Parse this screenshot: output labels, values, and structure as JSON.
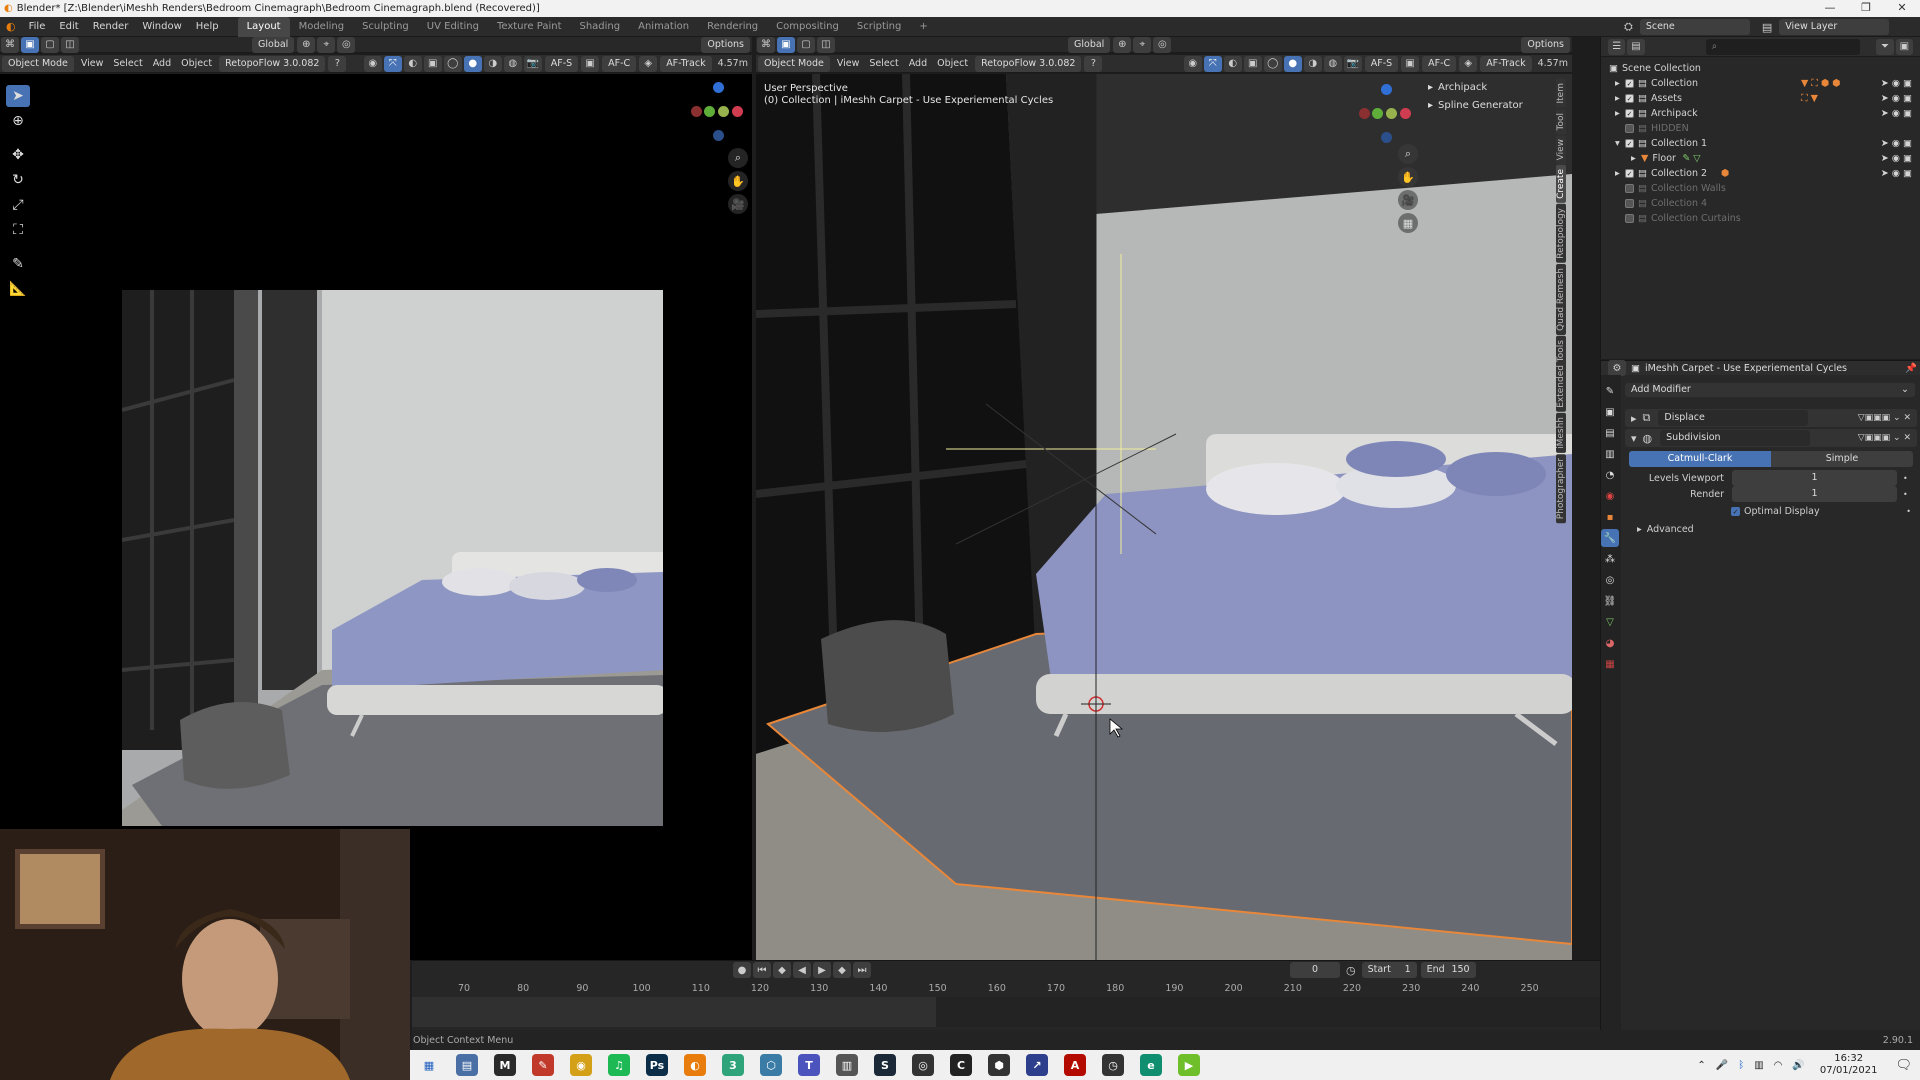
{
  "titlebar": {
    "text": "Blender* [Z:\\Blender\\iMeshh Renders\\Bedroom Cinemagraph\\Bedroom Cinemagraph.blend (Recovered)]"
  },
  "menu": [
    "File",
    "Edit",
    "Render",
    "Window",
    "Help"
  ],
  "workspaces": [
    "Layout",
    "Modeling",
    "Sculpting",
    "UV Editing",
    "Texture Paint",
    "Shading",
    "Animation",
    "Rendering",
    "Compositing",
    "Scripting"
  ],
  "active_workspace": "Layout",
  "scene": {
    "name": "Scene",
    "view_layer": "View Layer"
  },
  "left_viewport_header": {
    "mode": "Object Mode",
    "menus": [
      "View",
      "Select",
      "Add",
      "Object"
    ],
    "addon": "RetopoFlow 3.0.082",
    "orientation": "Global",
    "options": "Options",
    "af_s": "AF-S",
    "af_c": "AF-C",
    "af_track": "AF-Track",
    "distance": "4.57m"
  },
  "main_viewport_header": {
    "mode": "Object Mode",
    "menus": [
      "View",
      "Select",
      "Add",
      "Object"
    ],
    "addon": "RetopoFlow 3.0.082",
    "orientation": "Global",
    "options": "Options",
    "af_s": "AF-S",
    "af_c": "AF-C",
    "af_track": "AF-Track",
    "distance": "4.57m"
  },
  "main_viewport": {
    "perspective": "User Perspective",
    "collection_info": "(0) Collection | iMeshh Carpet - Use Experiemental Cycles",
    "n_panel_items": [
      "Archipack",
      "Spline Generator"
    ]
  },
  "n_panel_tabs": [
    "Item",
    "Tool",
    "View",
    "Create",
    "Retopology",
    "Quad Remesh",
    "Extended Tools",
    "iMeshh",
    "Photographer"
  ],
  "outliner": {
    "root": "Scene Collection",
    "items": [
      {
        "label": "Collection",
        "enabled": true
      },
      {
        "label": "Assets",
        "enabled": true
      },
      {
        "label": "Archipack",
        "enabled": true
      },
      {
        "label": "HIDDEN",
        "enabled": false
      },
      {
        "label": "Collection 1",
        "enabled": true
      },
      {
        "label": "Floor",
        "enabled": true
      },
      {
        "label": "Collection 2",
        "enabled": true
      },
      {
        "label": "Collection Walls",
        "enabled": false
      },
      {
        "label": "Collection 4",
        "enabled": false
      },
      {
        "label": "Collection Curtains",
        "enabled": false
      }
    ]
  },
  "properties": {
    "object_name": "iMeshh Carpet - Use Experiemental Cycles",
    "add_modifier": "Add Modifier",
    "modifiers": [
      {
        "name": "Displace"
      },
      {
        "name": "Subdivision"
      }
    ],
    "subdiv_types": [
      "Catmull-Clark",
      "Simple"
    ],
    "levels_viewport_label": "Levels Viewport",
    "levels_viewport": "1",
    "render_label": "Render",
    "render": "1",
    "optimal_display": "Optimal Display",
    "advanced": "Advanced"
  },
  "timeline": {
    "current_frame": "0",
    "start_label": "Start",
    "start": "1",
    "end_label": "End",
    "end": "150",
    "ticks": [
      "70",
      "80",
      "90",
      "100",
      "110",
      "120",
      "130",
      "140",
      "150",
      "160",
      "170",
      "180",
      "190",
      "200",
      "210",
      "220",
      "230",
      "240",
      "250"
    ]
  },
  "status": {
    "left": "Object Context Menu",
    "version": "2.90.1"
  },
  "taskbar": {
    "time": "16:32",
    "date": "07/01/2021",
    "icons": [
      {
        "name": "explorer",
        "glyph": "▤",
        "color": "#4a6fa5"
      },
      {
        "name": "app-m",
        "glyph": "M",
        "color": "#2a2a2a"
      },
      {
        "name": "pen",
        "glyph": "✎",
        "color": "#c0392b"
      },
      {
        "name": "chrome",
        "glyph": "◉",
        "color": "#d4a017"
      },
      {
        "name": "spotify",
        "glyph": "♫",
        "color": "#1db954"
      },
      {
        "name": "photoshop",
        "glyph": "Ps",
        "color": "#0c2d48"
      },
      {
        "name": "blender",
        "glyph": "◐",
        "color": "#e87d0d"
      },
      {
        "name": "app-3",
        "glyph": "3",
        "color": "#2fa37a"
      },
      {
        "name": "cube",
        "glyph": "⬡",
        "color": "#3a7ca5"
      },
      {
        "name": "teams",
        "glyph": "T",
        "color": "#4b53bc"
      },
      {
        "name": "files",
        "glyph": "▥",
        "color": "#555"
      },
      {
        "name": "steam",
        "glyph": "S",
        "color": "#1b2838"
      },
      {
        "name": "discord",
        "glyph": "◎",
        "color": "#333"
      },
      {
        "name": "app-c",
        "glyph": "C",
        "color": "#222"
      },
      {
        "name": "unity",
        "glyph": "⬢",
        "color": "#333"
      },
      {
        "name": "app-arrow",
        "glyph": "↗",
        "color": "#2d3e8c"
      },
      {
        "name": "acrobat",
        "glyph": "A",
        "color": "#b30b00"
      },
      {
        "name": "clock",
        "glyph": "◷",
        "color": "#333"
      },
      {
        "name": "edge",
        "glyph": "e",
        "color": "#0f8f6f"
      },
      {
        "name": "app-play",
        "glyph": "▶",
        "color": "#6fbf2a"
      }
    ]
  },
  "colors": {
    "accent": "#4772b3",
    "selection": "#e8873a"
  }
}
